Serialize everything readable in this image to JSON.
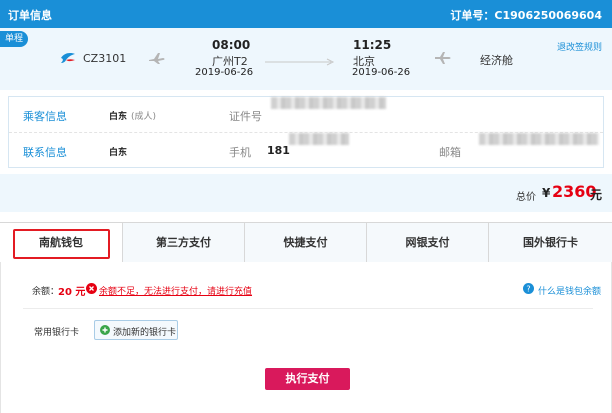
{
  "header": {
    "title": "订单信息",
    "order_no": "订单号：C1906250069604"
  },
  "flight": {
    "tag": "单程",
    "flight_no": "CZ3101",
    "dep_time": "08:00",
    "dep_city": "广州T2",
    "dep_date": "2019-06-26",
    "arr_time": "11:25",
    "arr_city": "北京",
    "arr_date": "2019-06-26",
    "cabin": "经济舱",
    "rules_link": "退改签规则"
  },
  "passenger": {
    "label": "乘客信息",
    "name": "白东",
    "type": "(成人)",
    "id_label": "证件号"
  },
  "contact": {
    "label": "联系信息",
    "name": "白东",
    "phone_label": "手机",
    "phone_prefix": "181",
    "email_label": "邮箱"
  },
  "total": {
    "label": "总价",
    "currency": "¥",
    "amount": "2360",
    "unit": "元"
  },
  "tabs": [
    "南航钱包",
    "第三方支付",
    "快捷支付",
    "网银支付",
    "国外银行卡"
  ],
  "wallet": {
    "balance_label": "余额：",
    "balance": "20 元",
    "warning": "余额不足，无法进行支付，请进行充值",
    "help": "什么是钱包余额",
    "bank_label": "常用银行卡",
    "add_card": "添加新的银行卡",
    "submit": "执行支付"
  },
  "colors": {
    "brand": "#1a8fd7",
    "price": "#e60012",
    "button": "#d9195c",
    "highlight": "#e31b23"
  }
}
